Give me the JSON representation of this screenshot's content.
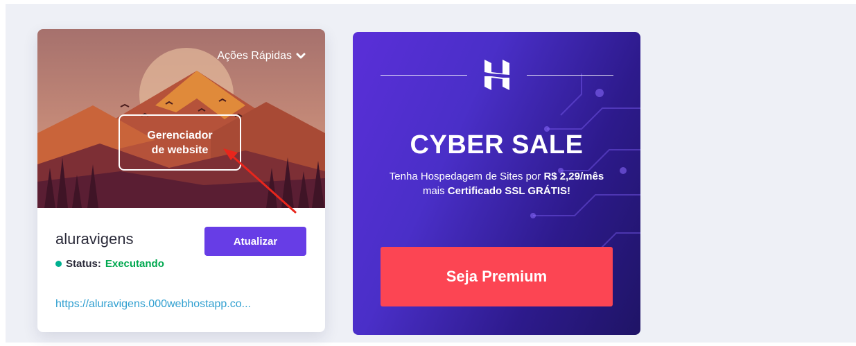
{
  "site_card": {
    "quick_actions_label": "Ações Rápidas",
    "manager_button_label_line1": "Gerenciador",
    "manager_button_label_line2": "de website",
    "site_name": "aluravigens",
    "update_button_label": "Atualizar",
    "status_label": "Status:",
    "status_value": "Executando",
    "site_url": "https://aluravigens.000webhostapp.co..."
  },
  "promo_card": {
    "title": "CYBER SALE",
    "text_part1": "Tenha Hospedagem de Sites por ",
    "text_price": "R$ 2,29/mês",
    "text_part2": " mais ",
    "text_ssl": "Certificado SSL GRÁTIS!",
    "cta_label": "Seja Premium"
  },
  "colors": {
    "primary": "#673de6",
    "status_green": "#00a84f",
    "cta_red": "#fc4553",
    "link_blue": "#2f9fd0",
    "annotation_red": "#e8261c"
  },
  "icons": {
    "chevron": "chevron-down-icon",
    "logo": "hostinger-logo-icon",
    "status_dot": "status-dot-icon"
  }
}
